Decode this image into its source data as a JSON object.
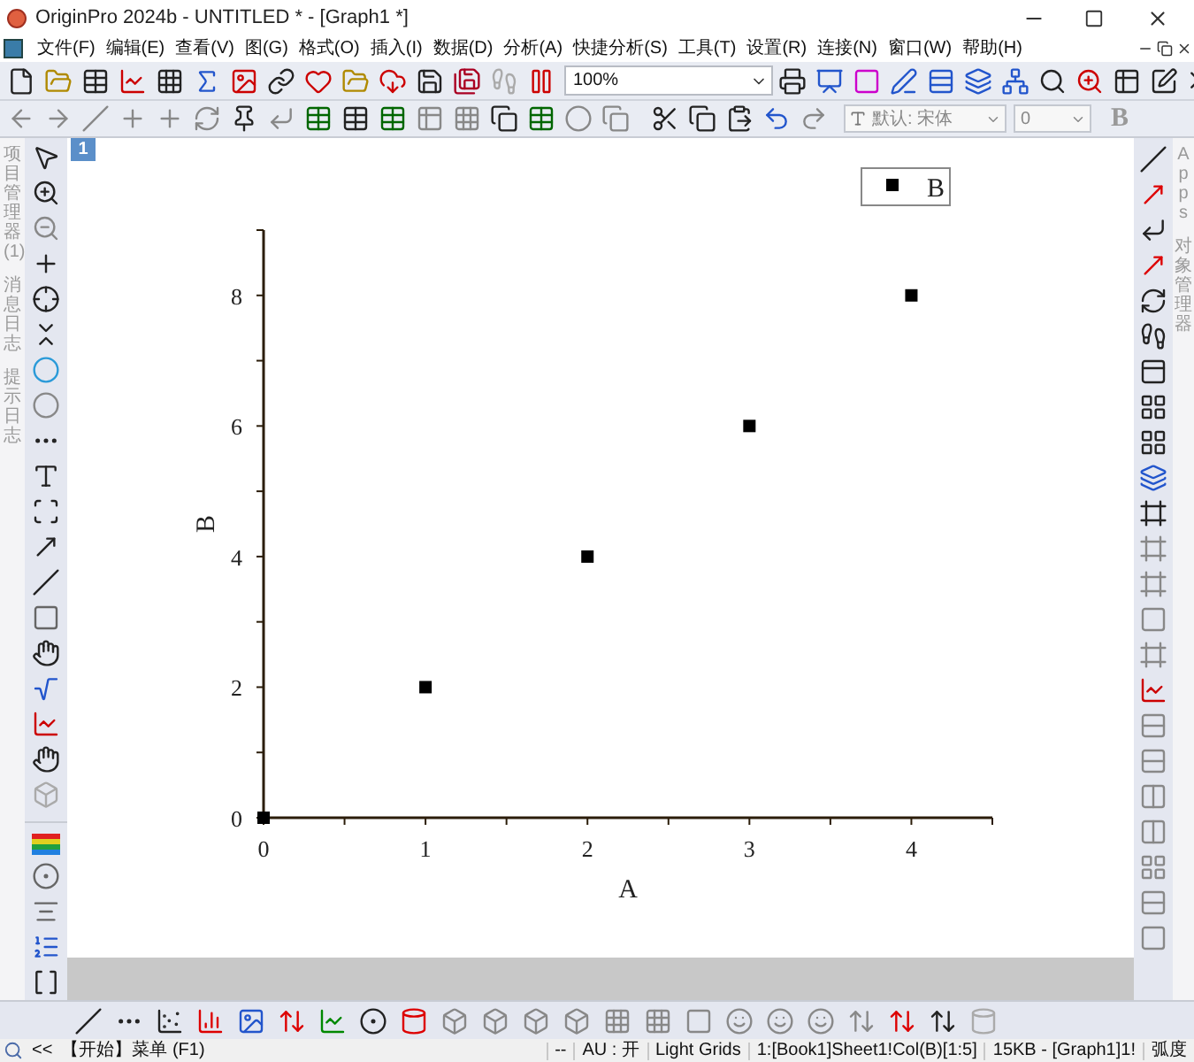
{
  "window": {
    "title": "OriginPro 2024b - UNTITLED * - [Graph1 *]"
  },
  "menu": [
    {
      "label": "文件(F)"
    },
    {
      "label": "编辑(E)"
    },
    {
      "label": "查看(V)"
    },
    {
      "label": "图(G)"
    },
    {
      "label": "格式(O)"
    },
    {
      "label": "插入(I)"
    },
    {
      "label": "数据(D)"
    },
    {
      "label": "分析(A)"
    },
    {
      "label": "快捷分析(S)"
    },
    {
      "label": "工具(T)"
    },
    {
      "label": "设置(R)"
    },
    {
      "label": "连接(N)"
    },
    {
      "label": "窗口(W)"
    },
    {
      "label": "帮助(H)"
    }
  ],
  "toolbar": {
    "zoom": "100%",
    "font": "默认: 宋体",
    "font_size": "0",
    "bold": "B"
  },
  "side_panels_left": [
    "项目管理器 (1)",
    "消息日志",
    "提示日志"
  ],
  "side_panels_right": [
    "Apps",
    "对象管理器"
  ],
  "graph": {
    "tab": "1",
    "chart_data": {
      "type": "scatter",
      "xlabel": "A",
      "ylabel": "B",
      "x": [
        0,
        1,
        2,
        3,
        4
      ],
      "series": [
        {
          "name": "B",
          "color": "#000000",
          "values": [
            0,
            2,
            4,
            6,
            8
          ]
        }
      ],
      "xlim": [
        0,
        4.5
      ],
      "ylim": [
        0,
        9
      ],
      "xticks": [
        0,
        1,
        2,
        3,
        4
      ],
      "yticks": [
        0,
        2,
        4,
        6,
        8
      ]
    }
  },
  "status_bar": [
    "<<",
    "【开始】菜单 (F1)",
    "--",
    "AU : 开",
    "Light Grids",
    "1:[Book1]Sheet1!Col(B)[1:5]",
    "15KB - [Graph1]1!",
    "弧度"
  ]
}
